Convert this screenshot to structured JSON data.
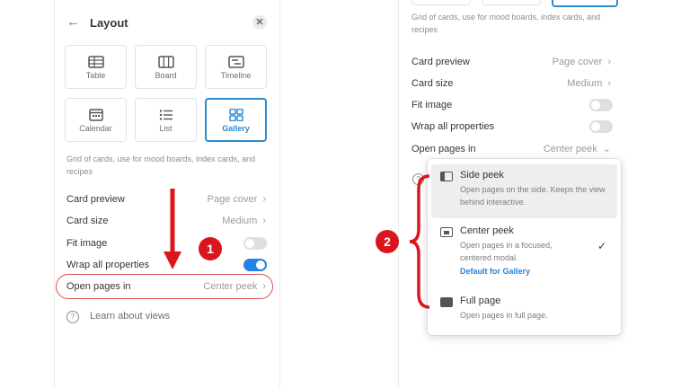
{
  "left": {
    "title": "Layout",
    "layouts": [
      {
        "label": "Table",
        "icon": "table-icon"
      },
      {
        "label": "Board",
        "icon": "board-icon"
      },
      {
        "label": "Timeline",
        "icon": "timeline-icon"
      },
      {
        "label": "Calendar",
        "icon": "calendar-icon"
      },
      {
        "label": "List",
        "icon": "list-icon"
      },
      {
        "label": "Gallery",
        "icon": "gallery-icon",
        "selected": true
      }
    ],
    "description": "Grid of cards, use for mood boards, index cards, and recipes",
    "settings": {
      "card_preview": {
        "label": "Card preview",
        "value": "Page cover"
      },
      "card_size": {
        "label": "Card size",
        "value": "Medium"
      },
      "fit_image": {
        "label": "Fit image",
        "on": false
      },
      "wrap_all": {
        "label": "Wrap all properties",
        "on": true
      },
      "open_pages": {
        "label": "Open pages in",
        "value": "Center peek"
      }
    },
    "learn": "Learn about views",
    "chevron": "›"
  },
  "right": {
    "description": "Grid of cards, use for mood boards, index cards, and recipes",
    "settings": {
      "card_preview": {
        "label": "Card preview",
        "value": "Page cover"
      },
      "card_size": {
        "label": "Card size",
        "value": "Medium"
      },
      "fit_image": {
        "label": "Fit image",
        "on": false
      },
      "wrap_all": {
        "label": "Wrap all properties",
        "on": false
      },
      "open_pages": {
        "label": "Open pages in",
        "value": "Center peek"
      }
    },
    "chevron_down": "⌄"
  },
  "menu": {
    "items": [
      {
        "title": "Side peek",
        "desc": "Open pages on the side. Keeps the view behind interactive."
      },
      {
        "title": "Center peek",
        "desc": "Open pages in a focused, centered modal.",
        "default": "Default for Gallery",
        "checked": true
      },
      {
        "title": "Full page",
        "desc": "Open pages in full page."
      }
    ],
    "check": "✓"
  },
  "annotations": {
    "badge1": "1",
    "badge2": "2"
  },
  "colors": {
    "accent": "#2383e2",
    "annotation_red": "#d9161c"
  }
}
